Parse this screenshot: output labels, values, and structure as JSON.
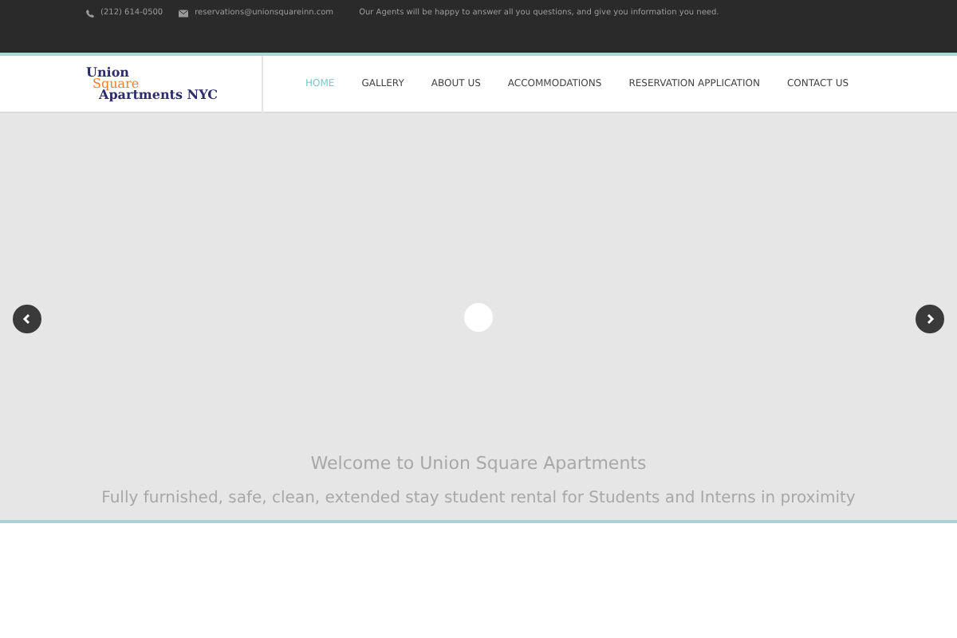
{
  "top_bar": {
    "phone": "(212) 614-0500",
    "email": "reservations@unionsquareinn.com",
    "message": "Our Agents will be happy to answer all you questions, and give you information you need."
  },
  "logo": {
    "line_1": "Union",
    "line_2": "Square",
    "line_3": "Apartments NYC"
  },
  "nav": [
    {
      "label": "HOME",
      "selected": true
    },
    {
      "label": "GALLERY",
      "selected": false
    },
    {
      "label": "ABOUT US",
      "selected": false
    },
    {
      "label": "ACCOMMODATIONS",
      "selected": false
    },
    {
      "label": "RESERVATION APPLICATION",
      "selected": false
    },
    {
      "label": "CONTACT US",
      "selected": false
    }
  ],
  "slider": {
    "heading": "Welcome to Union Square Apartments",
    "subtitle": "Fully furnished, safe, clean, extended stay student rental for Students and Interns in proximity"
  }
}
